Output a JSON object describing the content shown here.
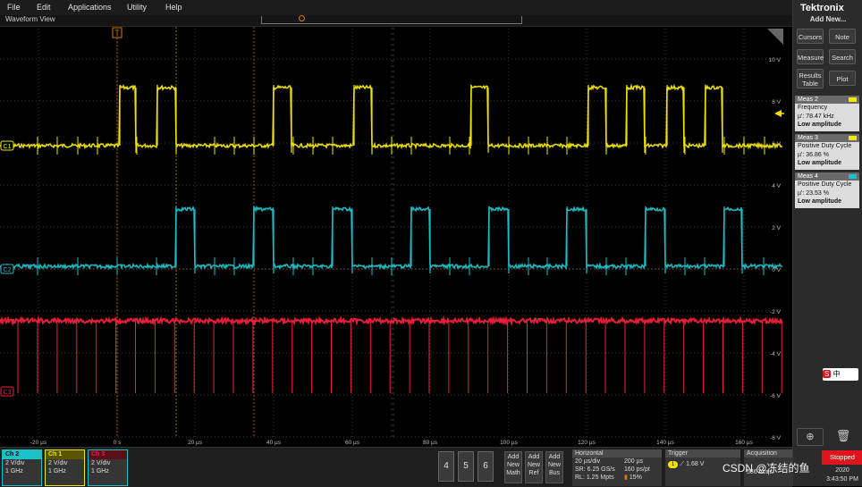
{
  "menu": {
    "items": [
      "File",
      "Edit",
      "Applications",
      "Utility",
      "Help"
    ]
  },
  "waveform": {
    "title": "Waveform View",
    "trigger_marker": "T",
    "time_labels": [
      "-20 µs",
      "0 s",
      "20 µs",
      "40 µs",
      "60 µs",
      "80 µs",
      "100 µs",
      "120 µs",
      "140 µs",
      "160 µs"
    ],
    "volt_labels": [
      "10 V",
      "8 V",
      "6 V",
      "4 V",
      "2 V",
      "0 V",
      "-2 V",
      "-4 V",
      "-6 V",
      "-8 V"
    ],
    "channel_markers": [
      "C1",
      "C2",
      "C3"
    ],
    "colors": {
      "ch1": "#f2e600",
      "ch2": "#1ec0c8",
      "ch3": "#f0203c",
      "grid": "#4a4a4a",
      "cursor": "#e07a00"
    }
  },
  "right_panel": {
    "brand": "Tektronix",
    "add_new": "Add New...",
    "buttons": {
      "cursors": "Cursors",
      "note": "Note",
      "measure": "Measure",
      "search": "Search",
      "results_table": "Results Table",
      "plot": "Plot"
    },
    "measurements": [
      {
        "title": "Meas 2",
        "label": "Frequency",
        "value": "µ': 78.47 kHz",
        "note": "Low amplitude",
        "color": "#f2e600"
      },
      {
        "title": "Meas 3",
        "label": "Positive Duty Cycle",
        "value": "µ': 36.86 %",
        "note": "Low amplitude",
        "color": "#f2e600"
      },
      {
        "title": "Meas 4",
        "label": "Positive Duty Cycle",
        "value": "µ': 23.53 %",
        "note": "Low amplitude",
        "color": "#1ec0c8"
      }
    ],
    "stopped": "Stopped",
    "date": "2020",
    "time": "3:43:50 PM"
  },
  "bottom": {
    "channels": [
      {
        "name": "Ch 2",
        "vdiv": "2 V/div",
        "bw": "1 GHz",
        "color": "#1ec0c8"
      },
      {
        "name": "Ch 1",
        "vdiv": "2 V/div",
        "bw": "1 GHz",
        "color": "#f2e600"
      },
      {
        "name": "Ch 3",
        "vdiv": "2 V/div",
        "bw": "1 GHz",
        "color": "#f0203c"
      }
    ],
    "num_buttons": [
      "4",
      "5",
      "6"
    ],
    "add_buttons": [
      {
        "l1": "Add",
        "l2": "New",
        "l3": "Math"
      },
      {
        "l1": "Add",
        "l2": "New",
        "l3": "Ref"
      },
      {
        "l1": "Add",
        "l2": "New",
        "l3": "Bus"
      }
    ],
    "horizontal": {
      "title": "Horizontal",
      "tdiv": "20 µs/div",
      "rec": "200 µs",
      "sr": "SR: 6.25 GS/s",
      "pt": "160 ps/pt",
      "rl": "RL: 1.25 Mpts",
      "pos": "15%"
    },
    "trigger": {
      "title": "Trigger",
      "ch": "1",
      "level": "1.68 V"
    },
    "acquisition": {
      "title": "Acquisition",
      "acqs": "586 Acqs"
    }
  },
  "watermark": "CSDN @冻结的鱼",
  "sohu_label": "中"
}
